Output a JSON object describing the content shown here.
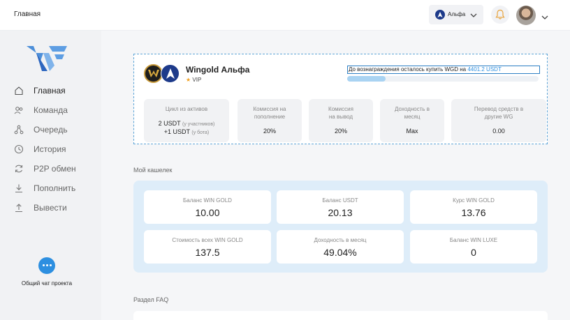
{
  "header": {
    "page_title": "Главная",
    "account_name": "Альфа",
    "colors": {
      "accent": "#2d8fe0",
      "account_dot": "#1d3a8a"
    }
  },
  "sidebar": {
    "items": [
      {
        "label": "Главная",
        "icon": "home-icon",
        "active": true
      },
      {
        "label": "Команда",
        "icon": "team-icon",
        "active": false
      },
      {
        "label": "Очередь",
        "icon": "queue-icon",
        "active": false
      },
      {
        "label": "История",
        "icon": "history-icon",
        "active": false
      },
      {
        "label": "P2P обмен",
        "icon": "exchange-icon",
        "active": false
      },
      {
        "label": "Пополнить",
        "icon": "deposit-icon",
        "active": false
      },
      {
        "label": "Вывести",
        "icon": "withdraw-icon",
        "active": false
      }
    ],
    "chat_label": "Общий чат проекта"
  },
  "token": {
    "name": "Wingold Альфа",
    "tier": "VIP",
    "progress_text": "До вознаграждения осталось купить WGD на",
    "progress_amount": "4401.2 USDT",
    "progress_fraction": 0.2
  },
  "stats": [
    {
      "title": "Цикл из активов",
      "line1": "2 USDT",
      "line1_note": "(у участников)",
      "line2": "+1 USDT",
      "line2_note": "(у бота)"
    },
    {
      "title": "Комиссия на пополнение",
      "value": "20%"
    },
    {
      "title": "Комиссия на вывод",
      "value": "20%"
    },
    {
      "title": "Доходность в месяц",
      "value": "Max"
    },
    {
      "title": "Перевод средств в другие WG",
      "value": "0.00"
    }
  ],
  "wallet": {
    "title": "Мой кашелек",
    "cards": [
      {
        "title": "Баланс WIN GOLD",
        "value": "10.00"
      },
      {
        "title": "Баланс USDT",
        "value": "20.13"
      },
      {
        "title": "Курс WIN GOLD",
        "value": "13.76"
      },
      {
        "title": "Стоимость всех WIN GOLD",
        "value": "137.5"
      },
      {
        "title": "Доходность в месяц",
        "value": "49.04%"
      },
      {
        "title": "Баланс WIN LUXE",
        "value": "0"
      }
    ]
  },
  "faq": {
    "title": "Раздел FAQ"
  }
}
